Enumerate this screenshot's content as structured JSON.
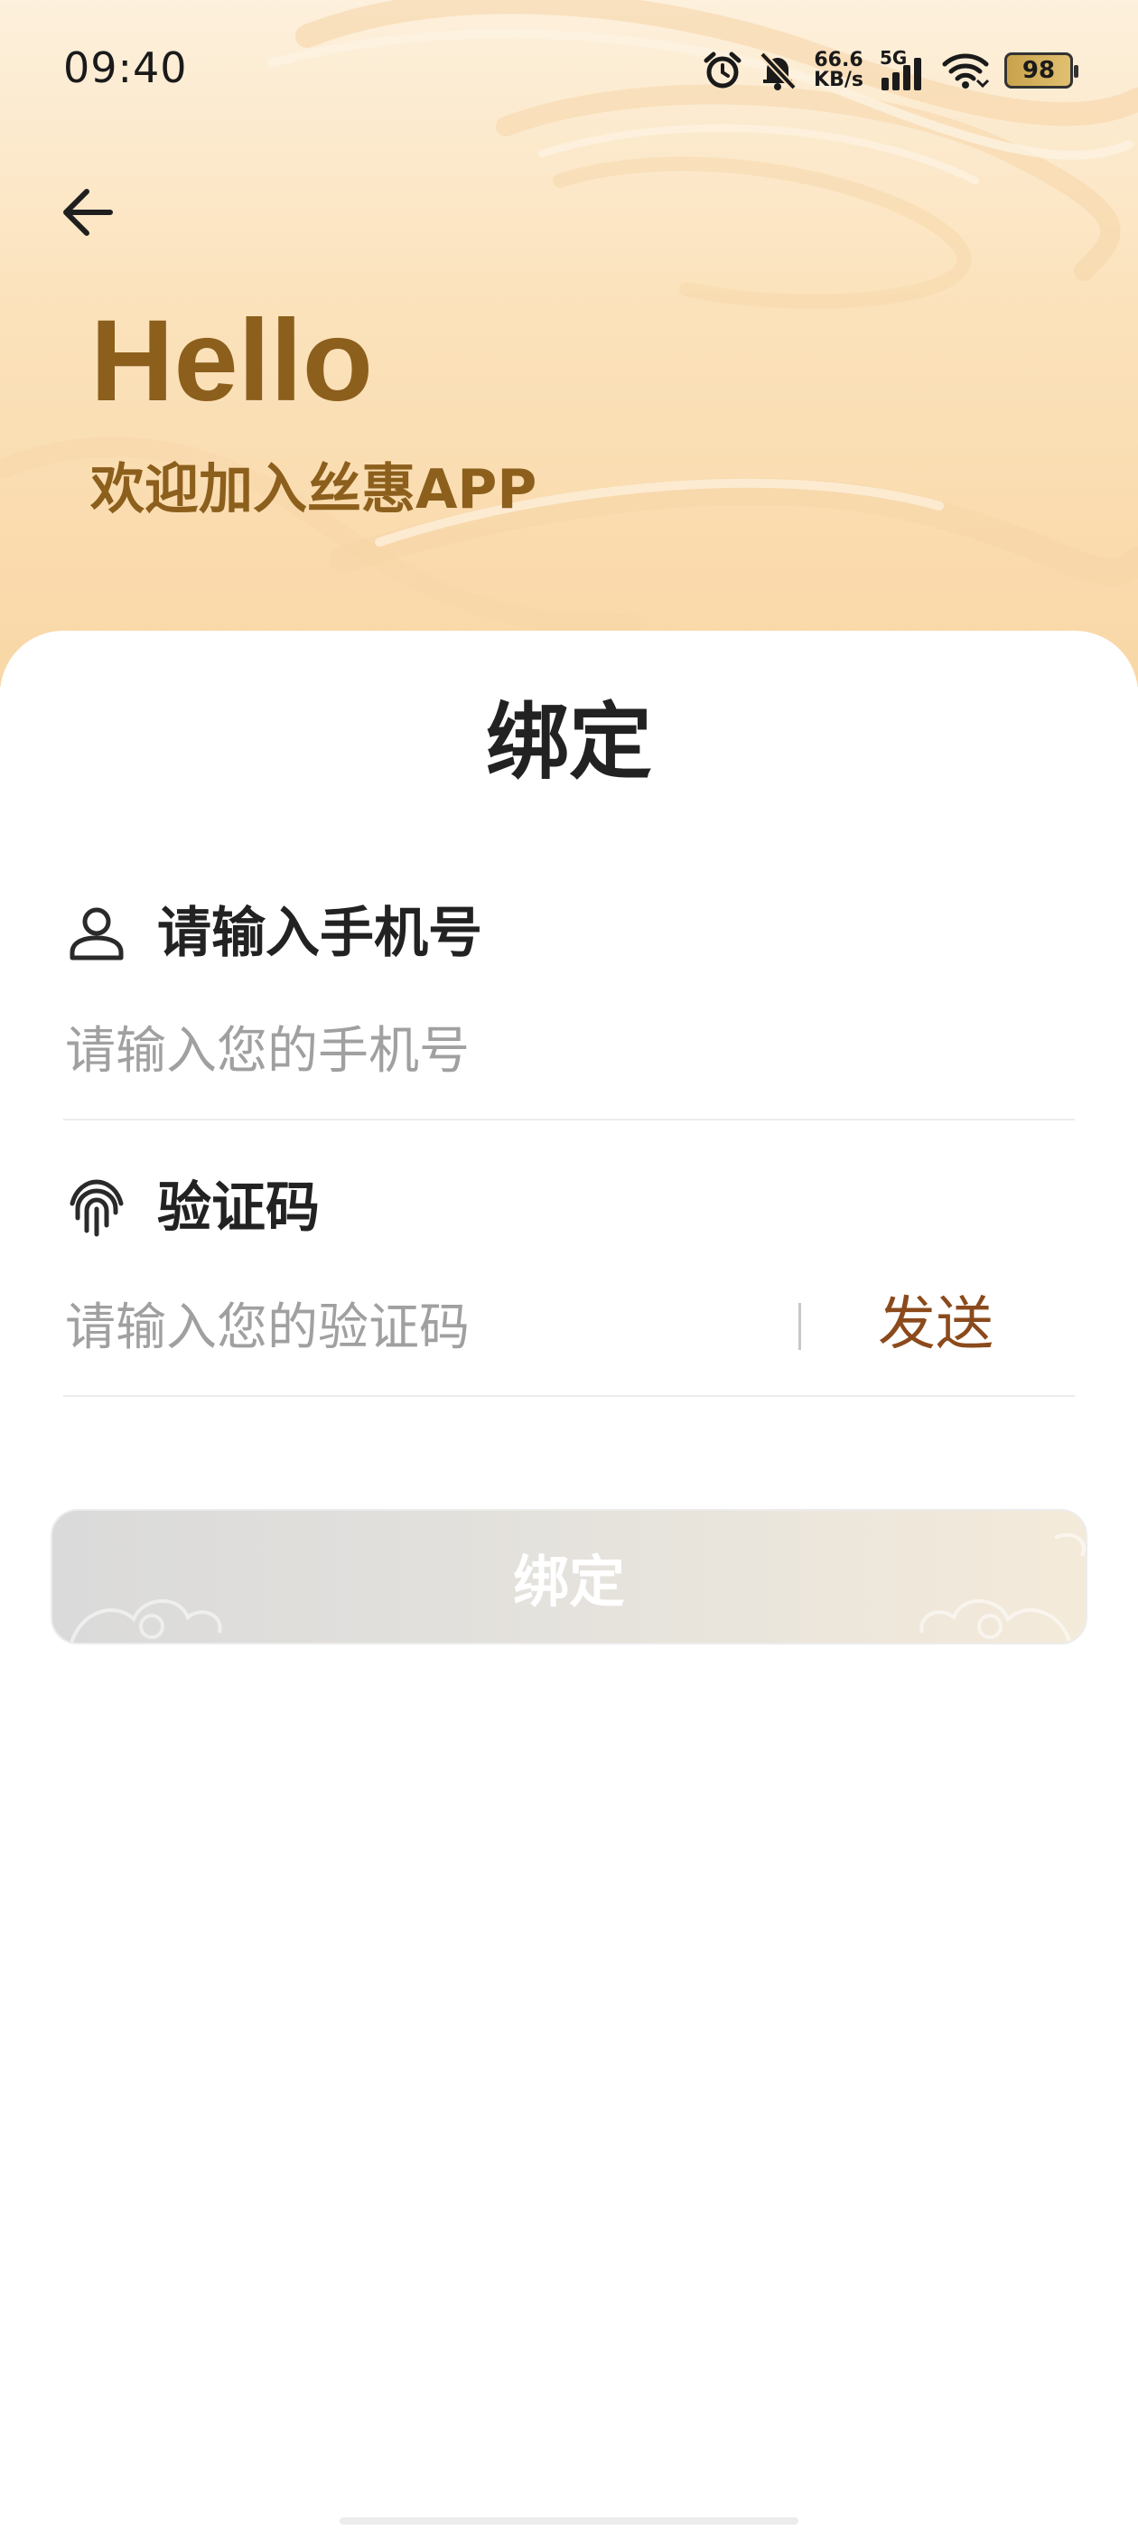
{
  "status_bar": {
    "time": "09:40",
    "net_speed_value": "66.6",
    "net_speed_unit": "KB/s",
    "network_type": "5G",
    "battery_level": "98",
    "icons": [
      "alarm-icon",
      "mute-bell-icon",
      "signal-icon",
      "wifi-icon",
      "battery-icon"
    ]
  },
  "header": {
    "back_icon": "arrow-left-icon",
    "greeting": "Hello",
    "welcome": "欢迎加入丝惠APP"
  },
  "card": {
    "title": "绑定",
    "phone": {
      "label": "请输入手机号",
      "placeholder": "请输入您的手机号",
      "value": "",
      "icon": "user-icon"
    },
    "code": {
      "label": "验证码",
      "placeholder": "请输入您的验证码",
      "value": "",
      "icon": "fingerprint-icon",
      "send_label": "发送"
    },
    "submit_label": "绑定"
  },
  "colors": {
    "brand": "#8c5f1d",
    "send": "#8b4a1c",
    "placeholder": "#a0a0a0"
  }
}
